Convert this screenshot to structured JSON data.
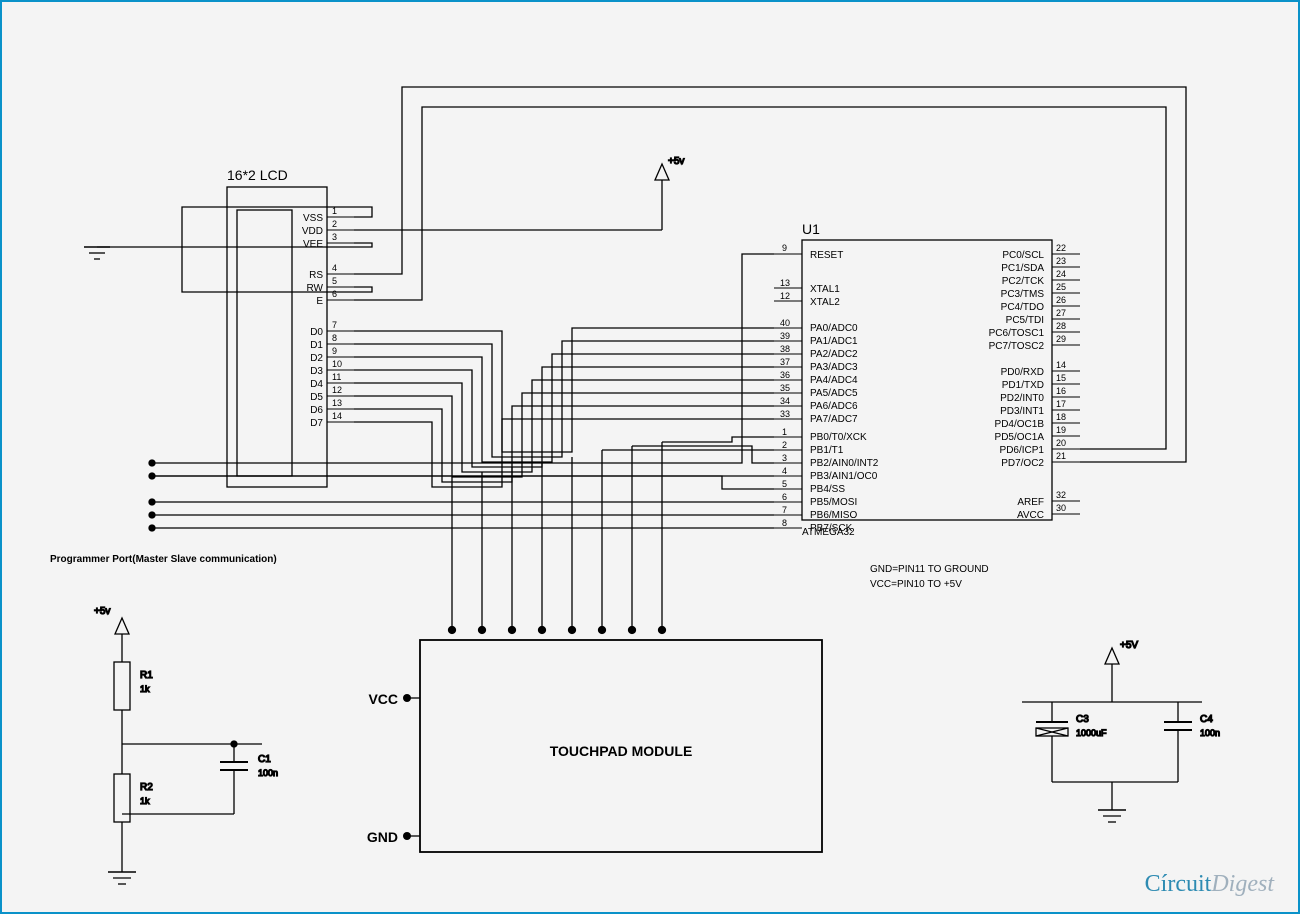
{
  "power": {
    "plus5v_a": "+5v",
    "plus5v_b": "+5v",
    "plus5v_c": "+5V"
  },
  "lcd": {
    "title": "16*2 LCD",
    "pins": [
      {
        "n": "1",
        "l": "VSS"
      },
      {
        "n": "2",
        "l": "VDD"
      },
      {
        "n": "3",
        "l": "VEE"
      },
      {
        "n": "4",
        "l": "RS"
      },
      {
        "n": "5",
        "l": "RW"
      },
      {
        "n": "6",
        "l": "E"
      },
      {
        "n": "7",
        "l": "D0"
      },
      {
        "n": "8",
        "l": "D1"
      },
      {
        "n": "9",
        "l": "D2"
      },
      {
        "n": "10",
        "l": "D3"
      },
      {
        "n": "11",
        "l": "D4"
      },
      {
        "n": "12",
        "l": "D5"
      },
      {
        "n": "13",
        "l": "D6"
      },
      {
        "n": "14",
        "l": "D7"
      }
    ]
  },
  "mcu": {
    "ref": "U1",
    "part": "ATMEGA32",
    "left": [
      {
        "n": "9",
        "l": "RESET"
      },
      {
        "n": "13",
        "l": "XTAL1"
      },
      {
        "n": "12",
        "l": "XTAL2"
      },
      {
        "n": "40",
        "l": "PA0/ADC0"
      },
      {
        "n": "39",
        "l": "PA1/ADC1"
      },
      {
        "n": "38",
        "l": "PA2/ADC2"
      },
      {
        "n": "37",
        "l": "PA3/ADC3"
      },
      {
        "n": "36",
        "l": "PA4/ADC4"
      },
      {
        "n": "35",
        "l": "PA5/ADC5"
      },
      {
        "n": "34",
        "l": "PA6/ADC6"
      },
      {
        "n": "33",
        "l": "PA7/ADC7"
      },
      {
        "n": "1",
        "l": "PB0/T0/XCK"
      },
      {
        "n": "2",
        "l": "PB1/T1"
      },
      {
        "n": "3",
        "l": "PB2/AIN0/INT2"
      },
      {
        "n": "4",
        "l": "PB3/AIN1/OC0"
      },
      {
        "n": "5",
        "l": "PB4/SS"
      },
      {
        "n": "6",
        "l": "PB5/MOSI"
      },
      {
        "n": "7",
        "l": "PB6/MISO"
      },
      {
        "n": "8",
        "l": "PB7/SCK"
      }
    ],
    "right": [
      {
        "n": "22",
        "l": "PC0/SCL"
      },
      {
        "n": "23",
        "l": "PC1/SDA"
      },
      {
        "n": "24",
        "l": "PC2/TCK"
      },
      {
        "n": "25",
        "l": "PC3/TMS"
      },
      {
        "n": "26",
        "l": "PC4/TDO"
      },
      {
        "n": "27",
        "l": "PC5/TDI"
      },
      {
        "n": "28",
        "l": "PC6/TOSC1"
      },
      {
        "n": "29",
        "l": "PC7/TOSC2"
      },
      {
        "n": "14",
        "l": "PD0/RXD"
      },
      {
        "n": "15",
        "l": "PD1/TXD"
      },
      {
        "n": "16",
        "l": "PD2/INT0"
      },
      {
        "n": "17",
        "l": "PD3/INT1"
      },
      {
        "n": "18",
        "l": "PD4/OC1B"
      },
      {
        "n": "19",
        "l": "PD5/OC1A"
      },
      {
        "n": "20",
        "l": "PD6/ICP1"
      },
      {
        "n": "21",
        "l": "PD7/OC2"
      },
      {
        "n": "32",
        "l": "AREF"
      },
      {
        "n": "30",
        "l": "AVCC"
      }
    ],
    "notes": [
      "GND=PIN11  TO  GROUND",
      "VCC=PIN10  TO  +5V"
    ]
  },
  "touchpad": {
    "title": "TOUCHPAD MODULE",
    "vcc": "VCC",
    "gnd": "GND"
  },
  "programmer": "Programmer Port(Master Slave communication)",
  "parts": {
    "r1": {
      "ref": "R1",
      "val": "1k"
    },
    "r2": {
      "ref": "R2",
      "val": "1k"
    },
    "c1": {
      "ref": "C1",
      "val": "100n"
    },
    "c3": {
      "ref": "C3",
      "val": "1000uF"
    },
    "c4": {
      "ref": "C4",
      "val": "100n"
    }
  },
  "logo": {
    "a": "Círcuit",
    "b": "Digest"
  }
}
